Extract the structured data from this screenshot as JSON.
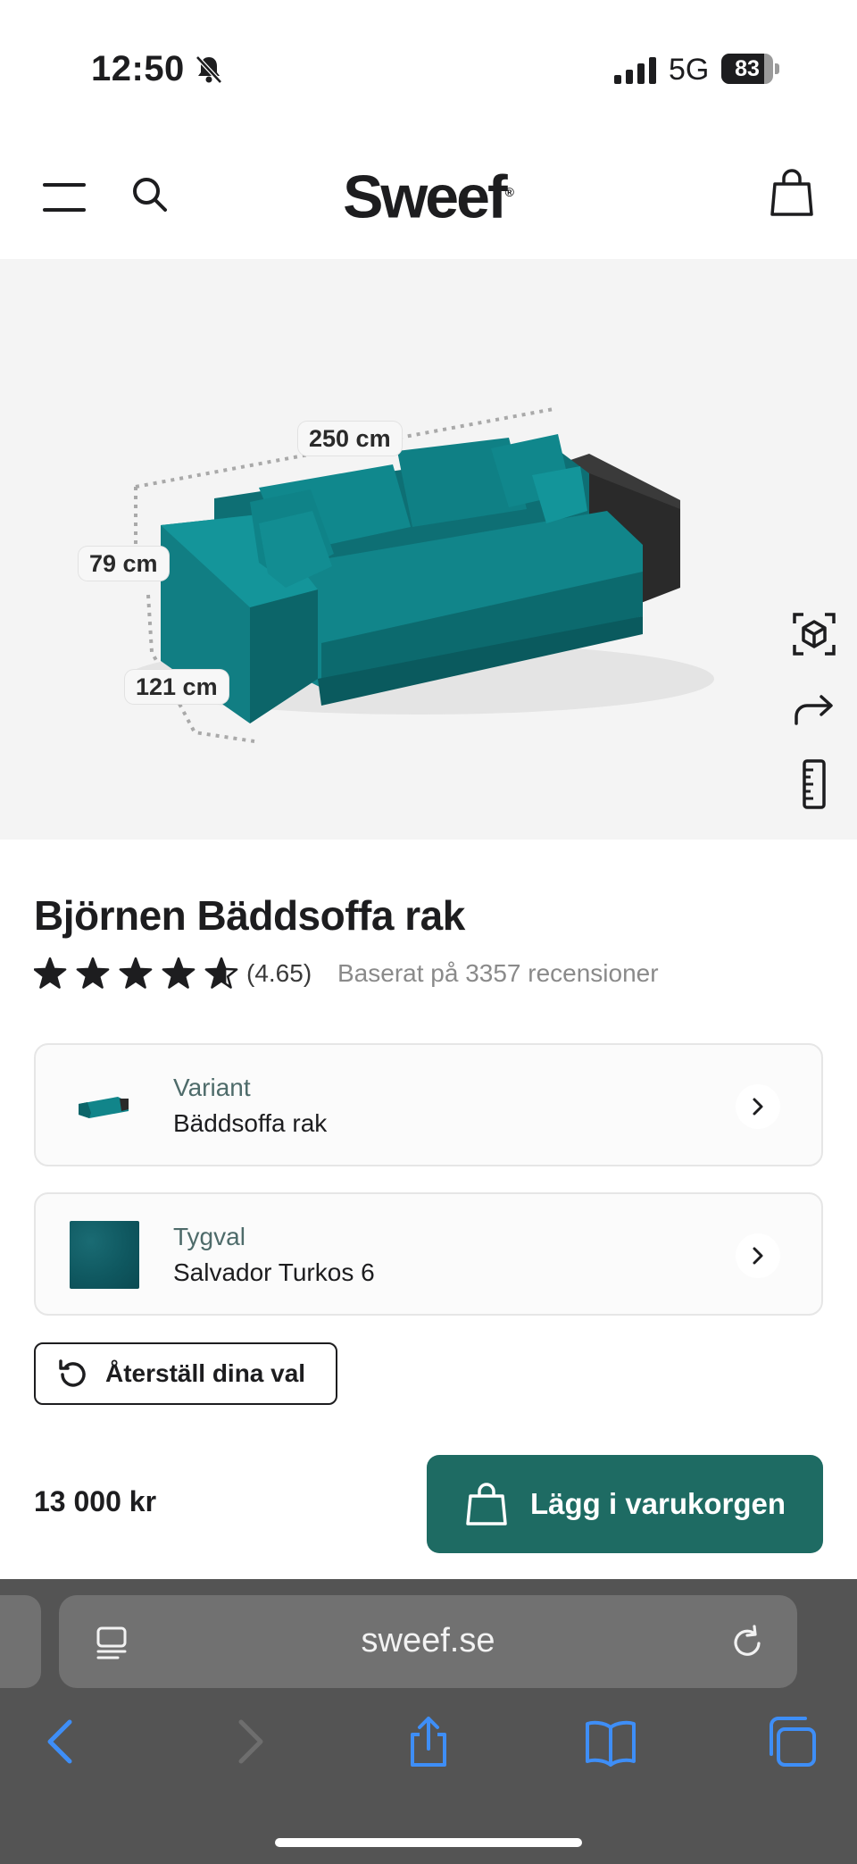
{
  "status_bar": {
    "time": "12:50",
    "network": "5G",
    "battery": "83",
    "battery_level": 0.83,
    "icons": [
      "bell-slash-icon",
      "signal-icon",
      "battery-icon"
    ]
  },
  "header": {
    "logo": "Sweef",
    "logo_mark": "®",
    "icons": [
      "menu-icon",
      "search-icon",
      "shopping-bag-icon"
    ]
  },
  "viewer": {
    "dimensions": {
      "width": "250 cm",
      "height": "79 cm",
      "depth": "121 cm"
    },
    "tools": [
      "ar-cube-icon",
      "share-arrow-icon",
      "ruler-icon"
    ],
    "colors": {
      "sofa": "#0f7a7e",
      "background": "#f4f4f4"
    }
  },
  "product": {
    "title": "Björnen Bäddsoffa rak",
    "rating_value": "(4.65)",
    "rating": 4.65,
    "rating_count_text": "Baserat på 3357 recensioner"
  },
  "options": {
    "variant": {
      "label": "Variant",
      "value": "Bäddsoffa rak"
    },
    "fabric": {
      "label": "Tygval",
      "value": "Salvador Turkos 6",
      "color": "#0f5860"
    }
  },
  "reset": {
    "label": "Återställ dina val"
  },
  "purchase": {
    "price": "13 000 kr",
    "cta_label": "Lägg i varukorgen",
    "cta_color": "#1e6b63"
  },
  "browser": {
    "url": "sweef.se",
    "toolbar": [
      "back-icon",
      "forward-icon",
      "share-icon",
      "bookmarks-icon",
      "tabs-icon"
    ],
    "accent": "#3e8ef7"
  }
}
